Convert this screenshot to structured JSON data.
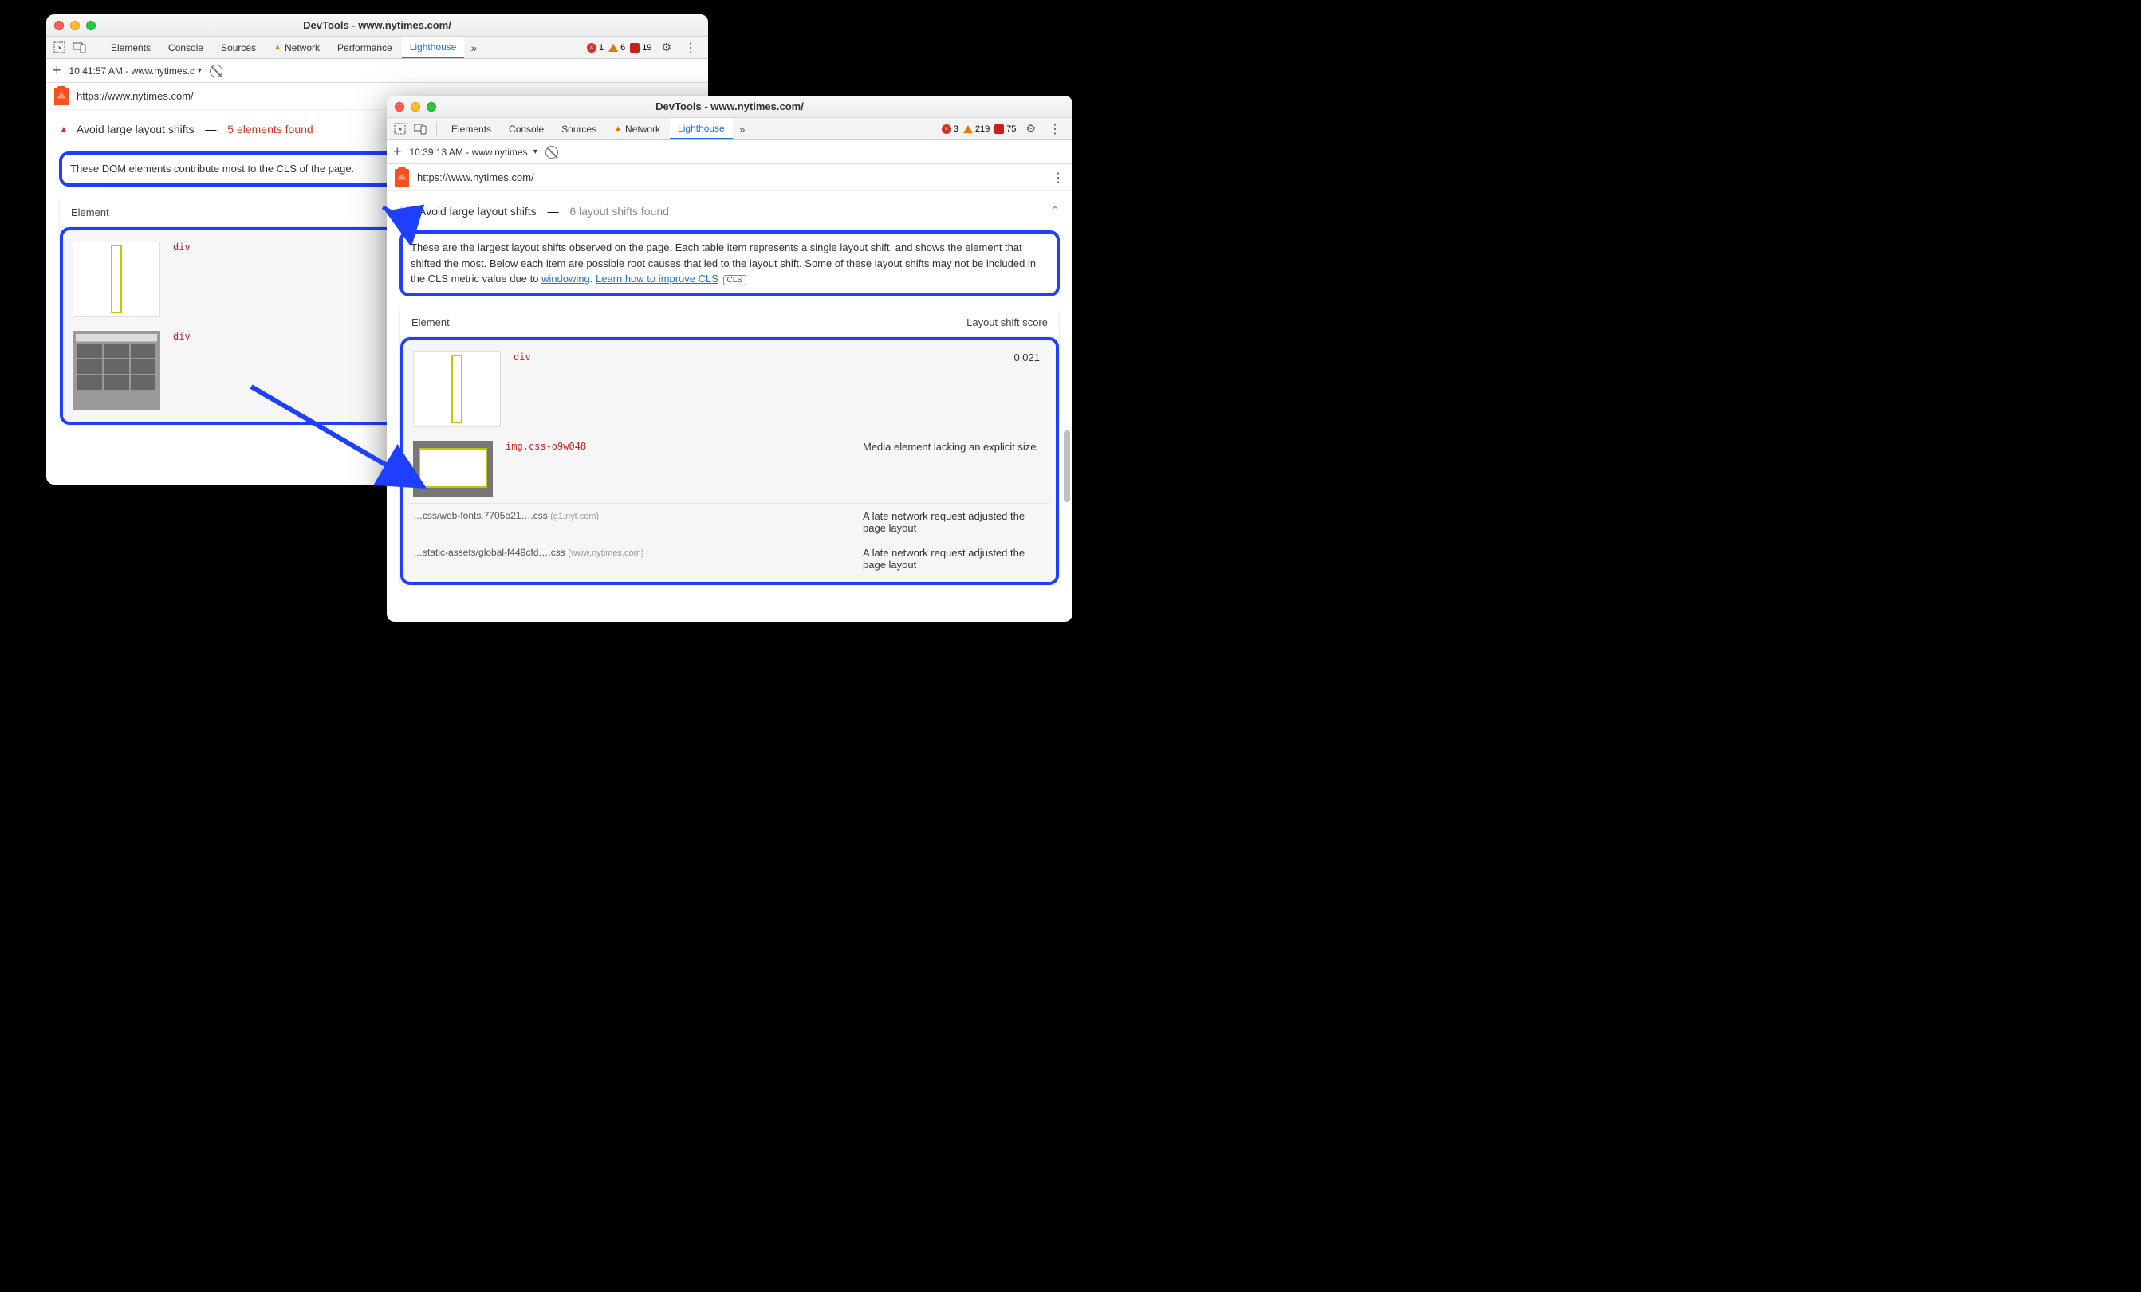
{
  "left": {
    "title": "DevTools - www.nytimes.com/",
    "tabs": [
      "Elements",
      "Console",
      "Sources",
      "Network",
      "Performance",
      "Lighthouse"
    ],
    "activeTab": "Lighthouse",
    "errors": "1",
    "warnings": "6",
    "coverage": "19",
    "run": "10:41:57 AM - www.nytimes.c",
    "url": "https://www.nytimes.com/",
    "audit": {
      "title": "Avoid large layout shifts",
      "countLabel": "5 elements found",
      "desc": "These DOM elements contribute most to the CLS of the page.",
      "header_element": "Element",
      "rows": [
        {
          "code": "div"
        },
        {
          "code": "div"
        }
      ]
    }
  },
  "right": {
    "title": "DevTools - www.nytimes.com/",
    "tabs": [
      "Elements",
      "Console",
      "Sources",
      "Network",
      "Lighthouse"
    ],
    "activeTab": "Lighthouse",
    "errors": "3",
    "warnings": "219",
    "coverage": "75",
    "run": "10:39:13 AM - www.nytimes.",
    "url": "https://www.nytimes.com/",
    "audit": {
      "title": "Avoid large layout shifts",
      "countLabel": "6 layout shifts found",
      "desc1": "These are the largest layout shifts observed on the page. Each table item represents a single layout shift, and shows the element that shifted the most. Below each item are possible root causes that led to the layout shift. Some of these layout shifts may not be included in the CLS metric value due to ",
      "link1": "windowing",
      "sep1": ". ",
      "link2": "Learn how to improve CLS",
      "clsBadge": "CLS",
      "header_element": "Element",
      "header_score": "Layout shift score",
      "row1": {
        "code": "div",
        "score": "0.021"
      },
      "row2": {
        "code": "img.css-o9w048",
        "cause": "Media element lacking an explicit size"
      },
      "row3": {
        "path": "…css/web-fonts.7705b21….css",
        "host": "(g1.nyt.com)",
        "cause": "A late network request adjusted the page layout"
      },
      "row4": {
        "path": "…static-assets/global-f449cfd….css",
        "host": "(www.nytimes.com)",
        "cause": "A late network request adjusted the page layout"
      }
    }
  }
}
